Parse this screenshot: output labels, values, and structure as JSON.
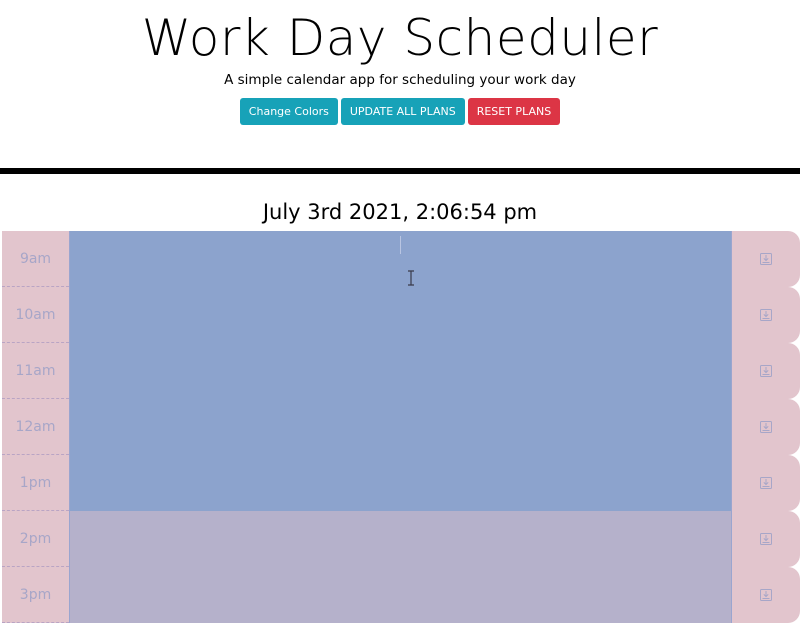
{
  "header": {
    "title": "Work Day Scheduler",
    "subtitle": "A simple calendar app for scheduling your work day",
    "buttons": {
      "change_colors": "Change Colors",
      "update_all": "UPDATE ALL PLANS",
      "reset": "RESET PLANS"
    }
  },
  "current_datetime": "July 3rd 2021, 2:06:54 pm",
  "colors": {
    "teal": "#17a2b8",
    "red": "#dc3545",
    "hour_block": "#e2c5cd",
    "present": "#8ca3cd",
    "future": "#b5b1cb"
  },
  "schedule": [
    {
      "hour": "9am",
      "state": "present",
      "plan": ""
    },
    {
      "hour": "10am",
      "state": "present",
      "plan": ""
    },
    {
      "hour": "11am",
      "state": "present",
      "plan": ""
    },
    {
      "hour": "12am",
      "state": "present",
      "plan": ""
    },
    {
      "hour": "1pm",
      "state": "present",
      "plan": ""
    },
    {
      "hour": "2pm",
      "state": "future",
      "plan": ""
    },
    {
      "hour": "3pm",
      "state": "future",
      "plan": ""
    }
  ],
  "icons": {
    "save": "save-icon",
    "cursor": "text-cursor-icon"
  }
}
